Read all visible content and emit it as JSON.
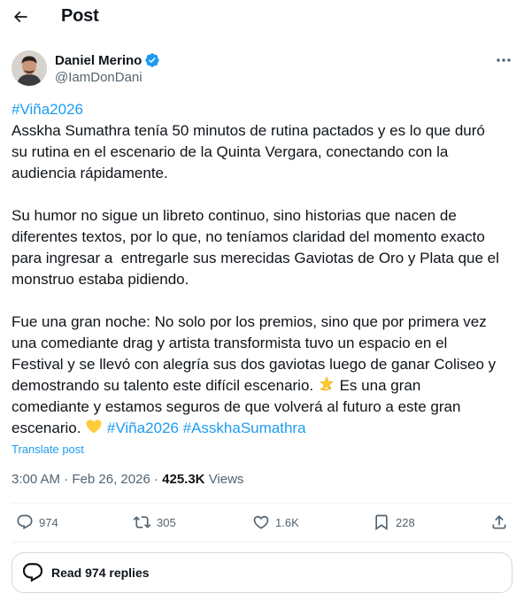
{
  "header": {
    "title": "Post"
  },
  "author": {
    "name": "Daniel Merino",
    "handle": "@IamDonDani",
    "verified": true
  },
  "tweet": {
    "hashtag_top": "#Viña2026",
    "line1": "Asskha Sumathra tenía 50 minutos de rutina pactados y es lo que duró",
    "line2": "su rutina en el escenario de la Quinta Vergara, conectando con la",
    "line3": "audiencia rápidamente.",
    "line4": "Su humor no sigue un libreto continuo, sino historias que nacen de",
    "line5": "diferentes textos, por lo que, no teníamos claridad del momento exacto",
    "line6": "para ingresar a  entregarle sus merecidas Gaviotas de Oro y Plata que el",
    "line7": "monstruo estaba pidiendo.",
    "line8": "Fue una gran noche: No solo por los premios, sino que por primera vez",
    "line9": "una comediante drag y artista transformista tuvo un espacio en el",
    "line10": "Festival y se llevó con alegría sus dos gaviotas luego de ganar Coliseo y",
    "line11_a": "demostrando su talento este difícil escenario.",
    "line11_b": " Es una gran",
    "line12": "comediante y estamos seguros de que volverá al futuro a este gran",
    "line13_a": "escenario.",
    "hashtag_1": "#Viña2026",
    "hashtag_2": "#AsskhaSumathra",
    "emoji_1": "dizzy-star-emoji",
    "emoji_2": "yellow-heart-emoji"
  },
  "translate_label": "Translate post",
  "meta": {
    "time": "3:00 AM",
    "date": "Feb 26, 2026",
    "views_count": "425.3K",
    "views_label": "Views",
    "sep": "·"
  },
  "actions": {
    "replies": "974",
    "reposts": "305",
    "likes": "1.6K",
    "bookmarks": "228"
  },
  "read_replies": {
    "label": "Read 974 replies"
  },
  "colors": {
    "accent": "#1d9bf0",
    "text": "#0f1419",
    "muted": "#536471",
    "border": "#cfd9de"
  }
}
